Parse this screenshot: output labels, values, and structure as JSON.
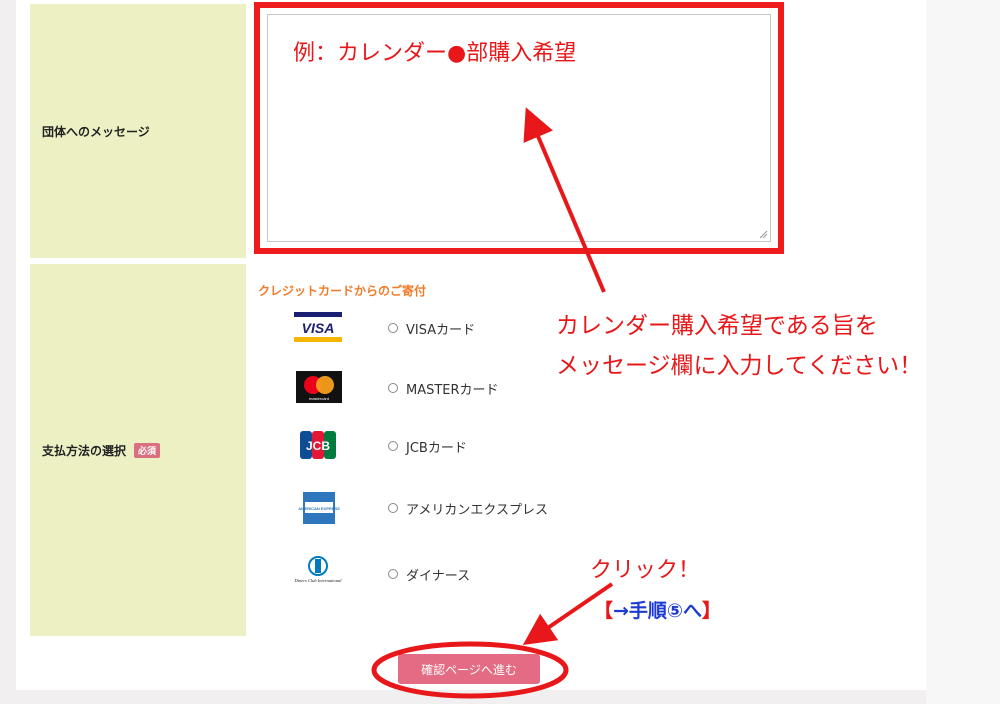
{
  "message_section": {
    "label": "団体へのメッセージ",
    "textarea_value": "例：カレンダー●部購入希望"
  },
  "payment_section": {
    "label": "支払方法の選択",
    "required_badge": "必須",
    "heading": "クレジットカードからのご寄付",
    "options": [
      {
        "label": "VISAカード",
        "icon": "visa-logo"
      },
      {
        "label": "MASTERカード",
        "icon": "mastercard-logo"
      },
      {
        "label": "JCBカード",
        "icon": "jcb-logo"
      },
      {
        "label": "アメリカンエクスプレス",
        "icon": "amex-logo"
      },
      {
        "label": "ダイナース",
        "icon": "diners-club-logo"
      }
    ],
    "logo_texts": {
      "visa": "VISA",
      "mastercard": "mastercard",
      "jcb": "JCB",
      "amex": "AMERICAN EXPRESS",
      "diners": "Diners Club International"
    }
  },
  "confirm_button": "確認ページへ進む",
  "annotations": {
    "instruction_line1": "カレンダー購入希望である旨を",
    "instruction_line2": "メッセージ欄に入力してください！",
    "click": "クリック！",
    "step_open": "【",
    "step_text": "→手順⑤へ",
    "step_close": "】"
  },
  "colors": {
    "annotation_red": "#e8181a",
    "label_bg": "#ecf0c2",
    "button_pink": "#e36b83",
    "heading_orange": "#f07b2a",
    "step_blue": "#1d3bd1"
  }
}
